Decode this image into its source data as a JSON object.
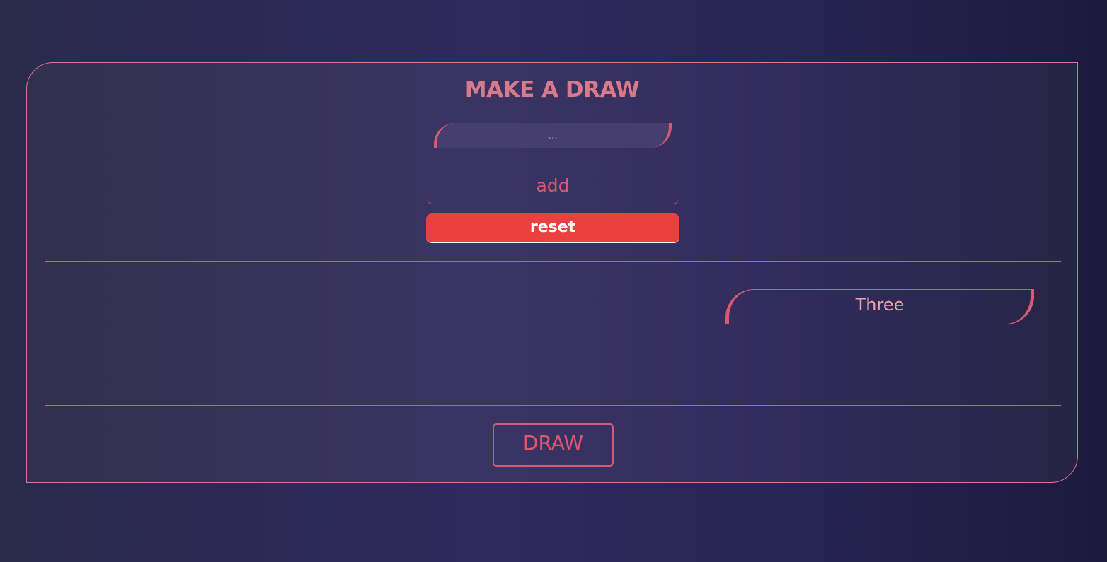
{
  "header": {
    "title": "MAKE A DRAW"
  },
  "form": {
    "name_placeholder": "...",
    "name_value": "",
    "add_label": "add",
    "reset_label": "reset"
  },
  "entries": [
    {
      "label": "Three"
    }
  ],
  "footer": {
    "draw_label": "DRAW"
  },
  "colors": {
    "accent": "#d85a72",
    "reset": "#ea4040",
    "title": "#d97a8c"
  }
}
